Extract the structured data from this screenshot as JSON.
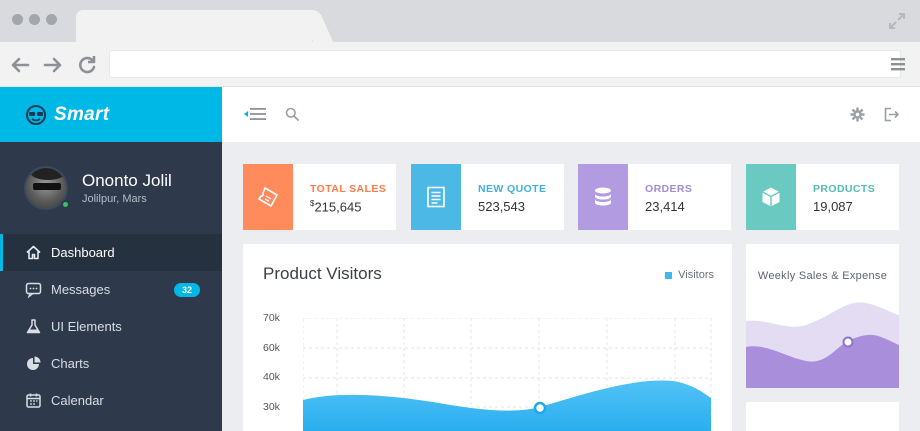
{
  "app": {
    "brand": "Smart"
  },
  "user": {
    "name": "Ononto Jolil",
    "location": "Jolilpur, Mars"
  },
  "sidebar": {
    "items": [
      {
        "label": "Dashboard",
        "icon": "home-icon",
        "active": true
      },
      {
        "label": "Messages",
        "icon": "chat-icon",
        "badge": "32"
      },
      {
        "label": "UI Elements",
        "icon": "flask-icon"
      },
      {
        "label": "Charts",
        "icon": "pie-icon"
      },
      {
        "label": "Calendar",
        "icon": "calendar-icon"
      }
    ]
  },
  "stats": [
    {
      "label": "TOTAL SALES",
      "prefix": "$",
      "value": "215,645",
      "color": "#ff8a5c",
      "icon": "ticket-icon"
    },
    {
      "label": "NEW QUOTE",
      "value": "523,543",
      "color": "#4bb8e6",
      "icon": "document-icon"
    },
    {
      "label": "ORDERS",
      "value": "23,414",
      "color": "#b29be0",
      "icon": "database-icon"
    },
    {
      "label": "PRODUCTS",
      "value": "19,087",
      "color": "#6ac9c0",
      "icon": "cube-icon"
    }
  ],
  "visitors": {
    "title": "Product Visitors",
    "legend": "Visitors",
    "y_ticks": [
      "70k",
      "60k",
      "40k",
      "30k"
    ]
  },
  "weekly": {
    "title": "Weekly Sales & Expense"
  },
  "colors": {
    "accent": "#00b8e6",
    "sidebar": "#2e3a4b",
    "chart_blue": "#3fb8ee"
  }
}
